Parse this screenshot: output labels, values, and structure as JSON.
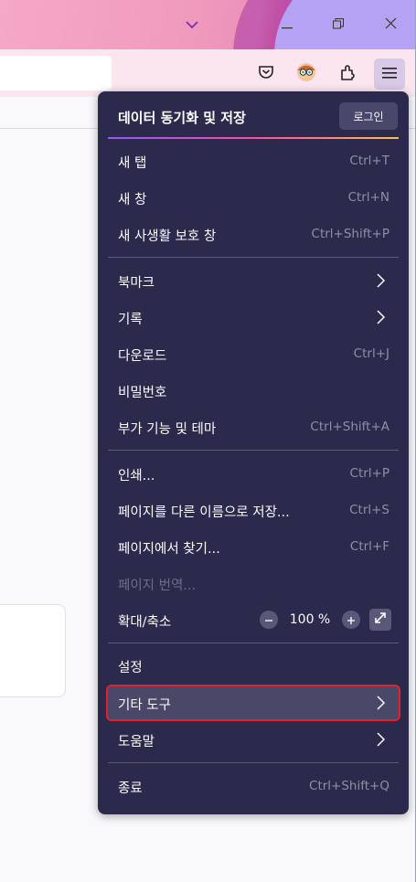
{
  "menu": {
    "header": {
      "title": "데이터 동기화 및 저장",
      "signin_label": "로그인"
    },
    "group1": [
      {
        "label": "새 탭",
        "shortcut": "Ctrl+T"
      },
      {
        "label": "새 창",
        "shortcut": "Ctrl+N"
      },
      {
        "label": "새 사생활 보호 창",
        "shortcut": "Ctrl+Shift+P"
      }
    ],
    "group2": [
      {
        "label": "북마크",
        "shortcut": ""
      },
      {
        "label": "기록",
        "shortcut": ""
      },
      {
        "label": "다운로드",
        "shortcut": "Ctrl+J"
      },
      {
        "label": "비밀번호",
        "shortcut": ""
      },
      {
        "label": "부가 기능 및 테마",
        "shortcut": "Ctrl+Shift+A"
      }
    ],
    "group3": [
      {
        "label": "인쇄...",
        "shortcut": "Ctrl+P"
      },
      {
        "label": "페이지를 다른 이름으로 저장...",
        "shortcut": "Ctrl+S"
      },
      {
        "label": "페이지에서 찾기...",
        "shortcut": "Ctrl+F"
      },
      {
        "label": "페이지 번역...",
        "shortcut": ""
      }
    ],
    "zoom": {
      "label": "확대/축소",
      "value": "100 %",
      "minus": "−",
      "plus": "+"
    },
    "group4": [
      {
        "label": "설정"
      },
      {
        "label": "기타 도구"
      },
      {
        "label": "도움말"
      }
    ],
    "exit": {
      "label": "종료",
      "shortcut": "Ctrl+Shift+Q"
    }
  },
  "icons": {
    "titlebar": [
      "chevron-down-icon",
      "minimize-icon",
      "restore-icon",
      "close-icon"
    ],
    "toolbar": [
      "pocket-icon",
      "account-avatar-icon",
      "extensions-icon",
      "hamburger-menu-icon"
    ]
  },
  "colors": {
    "menu_bg": "#2b2a4c",
    "highlight_outline": "#e0232f",
    "shortcut_text": "#8f8fa6"
  }
}
